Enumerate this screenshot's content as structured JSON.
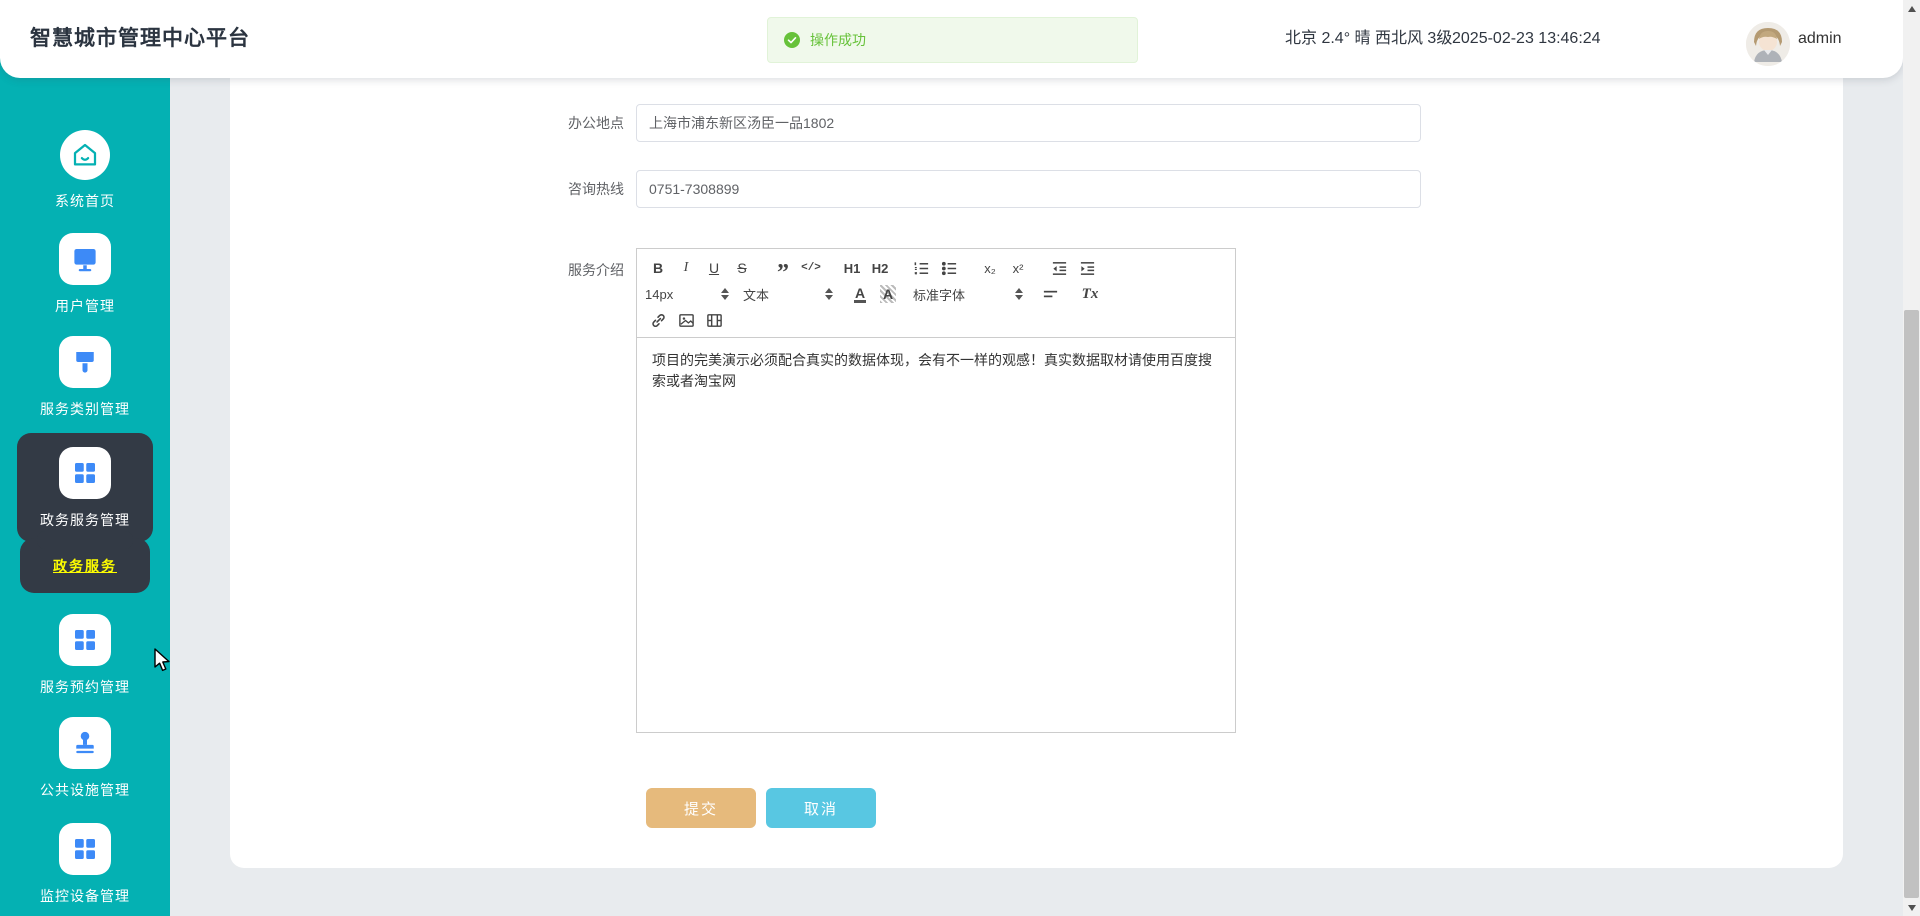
{
  "header": {
    "title": "智慧城市管理中心平台",
    "weather": "北京 2.4° 晴 西北风 3级",
    "datetime": "2025-02-23 13:46:24",
    "username": "admin"
  },
  "toast": {
    "message": "操作成功"
  },
  "sidebar": {
    "items": [
      {
        "label": "系统首页",
        "icon": "home-icon"
      },
      {
        "label": "用户管理",
        "icon": "monitor-icon"
      },
      {
        "label": "服务类别管理",
        "icon": "brush-icon"
      },
      {
        "label": "政务服务管理",
        "icon": "grid-icon",
        "active": true
      },
      {
        "label": "服务预约管理",
        "icon": "grid-icon"
      },
      {
        "label": "公共设施管理",
        "icon": "stamp-icon"
      },
      {
        "label": "监控设备管理",
        "icon": "grid-icon"
      }
    ],
    "submenu": {
      "label": "政务服务"
    }
  },
  "form": {
    "fields": [
      {
        "label": "办公地点",
        "value": "上海市浦东新区汤臣一品1802"
      },
      {
        "label": "咨询热线",
        "value": "0751-7308899"
      }
    ],
    "editor_label": "服务介绍"
  },
  "editor": {
    "toolbar": {
      "bold": "B",
      "italic": "I",
      "underline": "U",
      "strike": "S",
      "blockquote": "”",
      "code": "</>",
      "h1": "H1",
      "h2": "H2",
      "subscript": "x₂",
      "superscript": "x²",
      "size": "14px",
      "heading": "文本",
      "font": "标准字体",
      "color": "A",
      "background": "A",
      "clean": "Tx"
    },
    "content": "项目的完美演示必须配合真实的数据体现，会有不一样的观感！真实数据取材请使用百度搜索或者淘宝网"
  },
  "actions": {
    "submit": "提交",
    "cancel": "取消"
  },
  "colors": {
    "sidebar_teal": "#04b1b3",
    "active_dark": "#333a45",
    "submenu_yellow": "#fdfd00",
    "icon_blue": "#3d8af7",
    "toast_green": "#67c23a",
    "toast_bg": "#f0f9eb",
    "submit_btn": "#e6ba7c",
    "cancel_btn": "#58c7e2",
    "page_bg": "#e8ebee"
  }
}
